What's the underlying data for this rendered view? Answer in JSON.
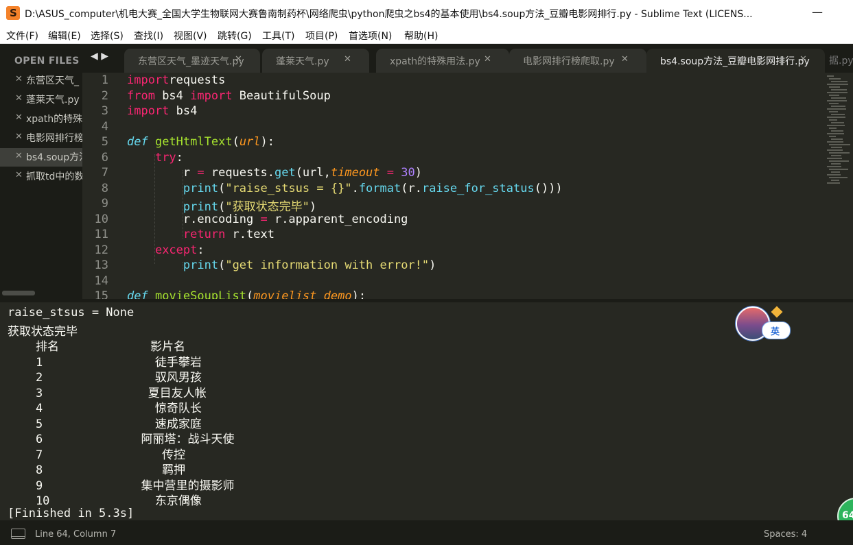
{
  "window": {
    "title": "D:\\ASUS_computer\\机电大赛_全国大学生物联网大赛鲁南制药杯\\网络爬虫\\python爬虫之bs4的基本使用\\bs4.soup方法_豆瓣电影网排行.py - Sublime Text (LICENS...",
    "app_icon_glyph": "S",
    "minimize_glyph": "—"
  },
  "menu": [
    "文件(F)",
    "编辑(E)",
    "选择(S)",
    "查找(I)",
    "视图(V)",
    "跳转(G)",
    "工具(T)",
    "项目(P)",
    "首选项(N)",
    "帮助(H)"
  ],
  "sidebar": {
    "header": "OPEN FILES",
    "close_glyph": "✕",
    "files": [
      {
        "label": "东营区天气_"
      },
      {
        "label": "蓬莱天气.py"
      },
      {
        "label": "xpath的特殊"
      },
      {
        "label": "电影网排行榜"
      },
      {
        "label": "bs4.soup方法",
        "active": true
      },
      {
        "label": "抓取td中的数"
      }
    ]
  },
  "tabs": {
    "nav_glyph": "◀ ▶",
    "close_glyph": "✕",
    "items": [
      {
        "label": "东营区天气_墨迹天气.py"
      },
      {
        "label": "蓬莱天气.py"
      },
      {
        "label": "xpath的特殊用法.py"
      },
      {
        "label": "电影网排行榜爬取.py"
      },
      {
        "label": "bs4.soup方法_豆瓣电影网排行.py",
        "active": true
      }
    ],
    "overflow_label": "据.py"
  },
  "code_lines": [
    {
      "n": "1",
      "tokens": [
        [
          "kw",
          "import"
        ],
        [
          "",
          "requests"
        ]
      ]
    },
    {
      "n": "2",
      "tokens": [
        [
          "kw",
          "from"
        ],
        [
          "",
          " bs4 "
        ],
        [
          "kw",
          "import"
        ],
        [
          "",
          " BeautifulSoup"
        ]
      ]
    },
    {
      "n": "3",
      "tokens": [
        [
          "kw",
          "import"
        ],
        [
          "",
          " bs4"
        ]
      ]
    },
    {
      "n": "4",
      "tokens": []
    },
    {
      "n": "5",
      "tokens": [
        [
          "df",
          "def"
        ],
        [
          "",
          " "
        ],
        [
          "fn",
          "getHtmlText"
        ],
        [
          "",
          "("
        ],
        [
          "pa",
          "url"
        ],
        [
          "",
          "):"
        ]
      ]
    },
    {
      "n": "6",
      "tokens": [
        [
          "",
          "    "
        ],
        [
          "kw",
          "try"
        ],
        [
          "",
          ":"
        ]
      ]
    },
    {
      "n": "7",
      "tokens": [
        [
          "",
          "        r "
        ],
        [
          "kw",
          "="
        ],
        [
          "",
          " requests."
        ],
        [
          "bi",
          "get"
        ],
        [
          "",
          "(url,"
        ],
        [
          "pa",
          "timeout"
        ],
        [
          "",
          " "
        ],
        [
          "kw",
          "="
        ],
        [
          "",
          " "
        ],
        [
          "nm",
          "30"
        ],
        [
          "",
          ")"
        ]
      ]
    },
    {
      "n": "8",
      "tokens": [
        [
          "",
          "        "
        ],
        [
          "bi",
          "print"
        ],
        [
          "",
          "("
        ],
        [
          "st",
          "\"raise_stsus = {}\""
        ],
        [
          "",
          "."
        ],
        [
          "bi",
          "format"
        ],
        [
          "",
          "(r."
        ],
        [
          "bi",
          "raise_for_status"
        ],
        [
          "",
          "()))"
        ]
      ]
    },
    {
      "n": "9",
      "tokens": [
        [
          "",
          "        "
        ],
        [
          "bi",
          "print"
        ],
        [
          "",
          "("
        ],
        [
          "st",
          "\"获取状态完毕\""
        ],
        [
          "",
          ")"
        ]
      ]
    },
    {
      "n": "10",
      "tokens": [
        [
          "",
          "        r.encoding "
        ],
        [
          "kw",
          "="
        ],
        [
          "",
          " r.apparent_encoding"
        ]
      ]
    },
    {
      "n": "11",
      "tokens": [
        [
          "",
          "        "
        ],
        [
          "kw",
          "return"
        ],
        [
          "",
          " r.text"
        ]
      ]
    },
    {
      "n": "12",
      "tokens": [
        [
          "",
          "    "
        ],
        [
          "kw",
          "except"
        ],
        [
          "",
          ":"
        ]
      ]
    },
    {
      "n": "13",
      "tokens": [
        [
          "",
          "        "
        ],
        [
          "bi",
          "print"
        ],
        [
          "",
          "("
        ],
        [
          "st",
          "\"get information with error!\""
        ],
        [
          "",
          ")"
        ]
      ]
    },
    {
      "n": "14",
      "tokens": []
    },
    {
      "n": "15",
      "tokens": [
        [
          "df",
          "def"
        ],
        [
          "",
          " "
        ],
        [
          "fn",
          "movieSoupList"
        ],
        [
          "",
          "("
        ],
        [
          "pa",
          "movielist_demo"
        ],
        [
          "",
          "):"
        ]
      ]
    }
  ],
  "output": {
    "lines": [
      "raise_stsus = None",
      "获取状态完毕",
      "    排名             影片名",
      "    1                徒手攀岩",
      "    2                驭风男孩",
      "    3               夏目友人帐",
      "    4                惊奇队长",
      "    5                速成家庭",
      "    6              阿丽塔：战斗天使",
      "    7                 传控",
      "    8                 羁押",
      "    9              集中营里的摄影师",
      "    10               东京偶像",
      "[Finished in 5.3s]"
    ]
  },
  "status": {
    "position": "Line 64, Column 7",
    "indentation": "Spaces: 4"
  },
  "ime": {
    "label": "英"
  },
  "badge": {
    "label": "64"
  },
  "colors": {
    "keyword": "#f92672",
    "string": "#e6db74",
    "function": "#a6e22e",
    "builtin": "#66d9ef",
    "number": "#ae81ff",
    "param": "#fd971f",
    "background": "#272822",
    "sidebar": "#1b1c17"
  }
}
